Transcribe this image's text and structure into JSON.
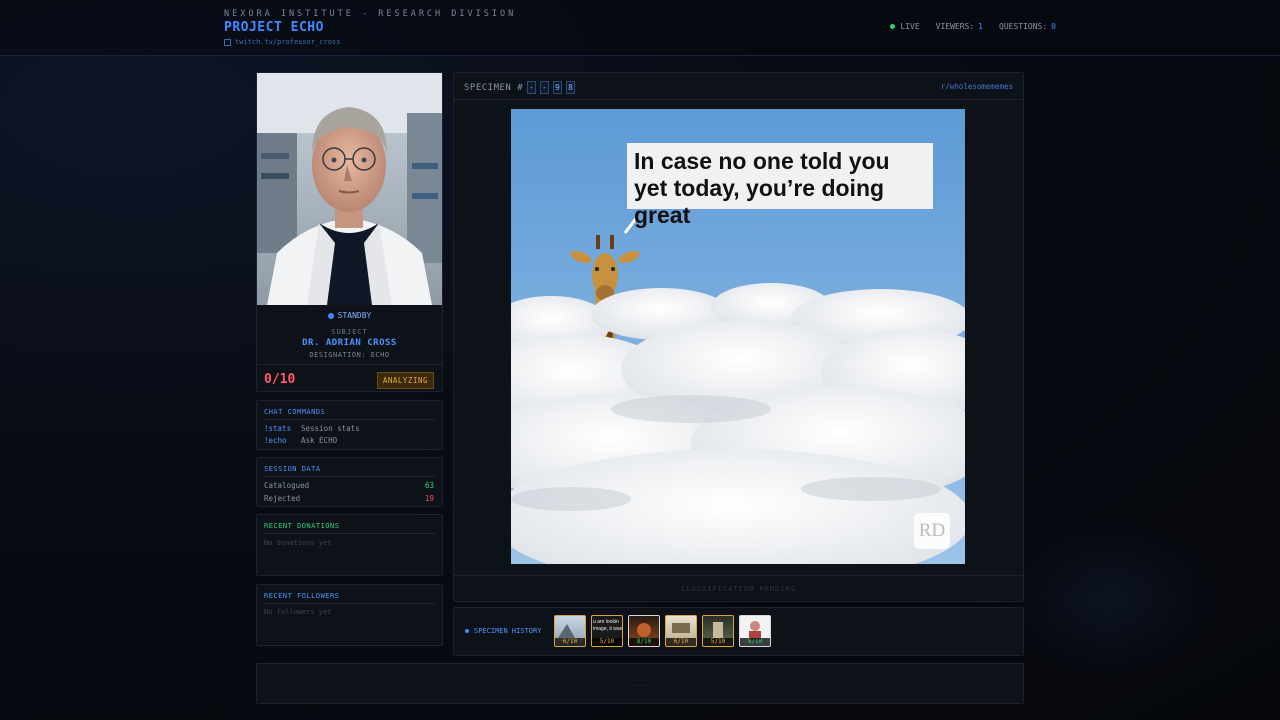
{
  "header": {
    "org": "NEXORA INSTITUTE - RESEARCH DIVISION",
    "title": "PROJECT ECHO",
    "channel": "twitch.tv/professor_cross",
    "live_label": "LIVE",
    "viewers_label": "VIEWERS:",
    "viewers": "1",
    "questions_label": "QUESTIONS:",
    "questions": "0"
  },
  "subject": {
    "status": "STANDBY",
    "label": "SUBJECT",
    "name": "DR. ADRIAN CROSS",
    "designation": "DESIGNATION: ECHO",
    "score": "0/10",
    "state": "ANALYZING"
  },
  "commands": {
    "title": "CHAT COMMANDS",
    "items": [
      {
        "key": "!stats",
        "desc": "Session stats"
      },
      {
        "key": "!echo",
        "desc": "Ask ECHO"
      }
    ]
  },
  "session": {
    "title": "SESSION DATA",
    "rows": [
      {
        "label": "Catalogued",
        "value": "63"
      },
      {
        "label": "Rejected",
        "value": "19"
      }
    ]
  },
  "donations": {
    "title": "RECENT DONATIONS",
    "empty": "No donations yet"
  },
  "followers": {
    "title": "RECENT FOLLOWERS",
    "empty": "No followers yet"
  },
  "specimen": {
    "label": "SPECIMEN #",
    "digits": [
      "-",
      "-",
      "9",
      "8"
    ],
    "subreddit": "r/wholesomememes",
    "caption": "In case no one told you yet today, you’re doing great",
    "logo": "RD",
    "classification": "CLASSIFICATION PENDING"
  },
  "history": {
    "label": "SPECIMEN HISTORY",
    "items": [
      {
        "score": "6/10",
        "caption": ""
      },
      {
        "score": "5/10",
        "caption": "u are lookin\nimage, it was"
      },
      {
        "score": "8/10",
        "caption": ""
      },
      {
        "score": "6/10",
        "caption": ""
      },
      {
        "score": "5/10",
        "caption": ""
      },
      {
        "score": "8/10",
        "caption": ""
      }
    ]
  },
  "footer": {
    "text": "..."
  },
  "colors": {
    "accent": "#3d8bff",
    "live": "#22d67a",
    "score": "#ff5a67",
    "warning": "#f0a830",
    "positive": "#22d67a",
    "negative": "#ff4d5e"
  }
}
